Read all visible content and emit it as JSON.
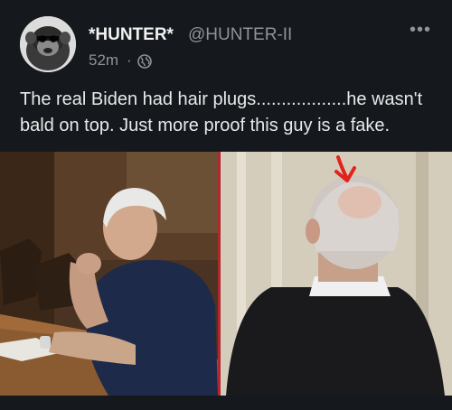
{
  "post": {
    "display_name": "*HUNTER*",
    "handle": "@HUNTER-II",
    "time": "52m",
    "separator": "·",
    "visibility_icon": "globe-icon",
    "more_label": "•••",
    "text": "The real Biden had hair plugs..................he wasn't bald on top. Just more proof this guy is a fake."
  },
  "media": {
    "left_photo": "man-at-desk-photo",
    "right_photo": "man-back-of-head-photo",
    "annotation": "red-arrow-icon",
    "annotation_color": "#e0241b"
  },
  "colors": {
    "background": "#15181c",
    "text": "#e7e9ea",
    "muted": "#8e9499"
  }
}
